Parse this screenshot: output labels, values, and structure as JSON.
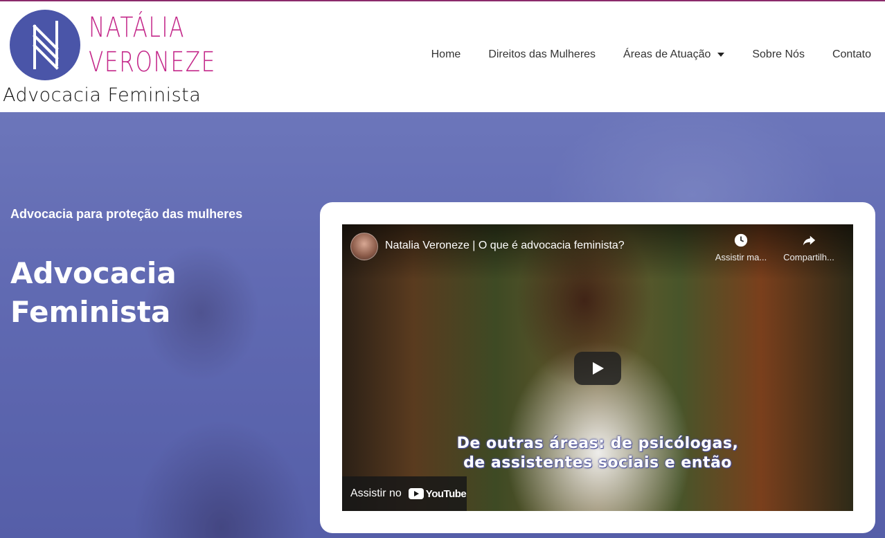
{
  "brand": {
    "logo_letter": "N",
    "name_line1": "NATÁLIA",
    "name_line2": "VERONEZE",
    "tagline": "Advocacia Feminista",
    "circle_color": "#4a55a8",
    "name_color": "#c4288a"
  },
  "nav": {
    "items": [
      {
        "label": "Home"
      },
      {
        "label": "Direitos das Mulheres"
      },
      {
        "label": "Áreas de Atuação",
        "has_dropdown": true
      },
      {
        "label": "Sobre Nós"
      },
      {
        "label": "Contato"
      }
    ]
  },
  "hero": {
    "kicker": "Advocacia para proteção das mulheres",
    "title_line1": "Advocacia",
    "title_line2": "Feminista"
  },
  "video": {
    "title": "Natalia Veroneze | O que é advocacia feminista?",
    "watch_later_label": "Assistir ma...",
    "share_label": "Compartilh...",
    "caption_line1": "De outras áreas: de psicólogas,",
    "caption_line2": "de assistentes sociais e então",
    "watch_on_label": "Assistir no",
    "platform_label": "YouTube",
    "icons": [
      "clock-icon",
      "share-icon",
      "play-icon",
      "youtube-logo"
    ]
  }
}
